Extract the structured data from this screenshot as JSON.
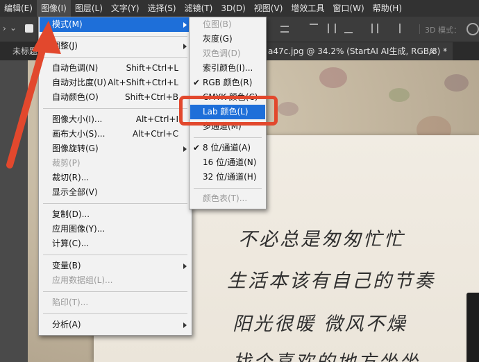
{
  "menubar": {
    "items": [
      "编辑(E)",
      "图像(I)",
      "图层(L)",
      "文字(Y)",
      "选择(S)",
      "滤镜(T)",
      "3D(D)",
      "视图(V)",
      "增效工具",
      "窗口(W)",
      "帮助(H)"
    ]
  },
  "options_bar": {
    "mode_label": "3D 模式："
  },
  "tabs": [
    {
      "label": "未标题"
    },
    {
      "label": "a47c.jpg @ 34.2% (StartAI AI生成, RGB/8) *"
    },
    {
      "close": "×"
    }
  ],
  "image_menu": {
    "items": [
      {
        "label": "模式(M)",
        "shortcut": "",
        "submenu": true,
        "state": "highlight"
      },
      {
        "label": "调整(J)",
        "shortcut": "",
        "submenu": true,
        "state": "normal"
      },
      {
        "label": "自动色调(N)",
        "shortcut": "Shift+Ctrl+L",
        "submenu": false,
        "state": "normal"
      },
      {
        "label": "自动对比度(U)",
        "shortcut": "Alt+Shift+Ctrl+L",
        "submenu": false,
        "state": "normal"
      },
      {
        "label": "自动颜色(O)",
        "shortcut": "Shift+Ctrl+B",
        "submenu": false,
        "state": "normal"
      },
      {
        "label": "图像大小(I)...",
        "shortcut": "Alt+Ctrl+I",
        "submenu": false,
        "state": "normal"
      },
      {
        "label": "画布大小(S)...",
        "shortcut": "Alt+Ctrl+C",
        "submenu": false,
        "state": "normal"
      },
      {
        "label": "图像旋转(G)",
        "shortcut": "",
        "submenu": true,
        "state": "normal"
      },
      {
        "label": "裁剪(P)",
        "shortcut": "",
        "submenu": false,
        "state": "disabled"
      },
      {
        "label": "裁切(R)...",
        "shortcut": "",
        "submenu": false,
        "state": "normal"
      },
      {
        "label": "显示全部(V)",
        "shortcut": "",
        "submenu": false,
        "state": "normal"
      },
      {
        "label": "复制(D)...",
        "shortcut": "",
        "submenu": false,
        "state": "normal"
      },
      {
        "label": "应用图像(Y)...",
        "shortcut": "",
        "submenu": false,
        "state": "normal"
      },
      {
        "label": "计算(C)...",
        "shortcut": "",
        "submenu": false,
        "state": "normal"
      },
      {
        "label": "变量(B)",
        "shortcut": "",
        "submenu": true,
        "state": "normal"
      },
      {
        "label": "应用数据组(L)...",
        "shortcut": "",
        "submenu": false,
        "state": "disabled"
      },
      {
        "label": "陷印(T)...",
        "shortcut": "",
        "submenu": false,
        "state": "disabled"
      },
      {
        "label": "分析(A)",
        "shortcut": "",
        "submenu": true,
        "state": "normal"
      }
    ]
  },
  "mode_menu": {
    "items": [
      {
        "label": "位图(B)",
        "checked": false,
        "state": "disabled"
      },
      {
        "label": "灰度(G)",
        "checked": false,
        "state": "normal"
      },
      {
        "label": "双色调(D)",
        "checked": false,
        "state": "disabled"
      },
      {
        "label": "索引颜色(I)...",
        "checked": false,
        "state": "normal"
      },
      {
        "label": "RGB 颜色(R)",
        "checked": true,
        "state": "normal"
      },
      {
        "label": "CMYK 颜色(C)",
        "checked": false,
        "state": "normal"
      },
      {
        "label": "Lab 颜色(L)",
        "checked": false,
        "state": "highlight"
      },
      {
        "label": "多通道(M)",
        "checked": false,
        "state": "normal"
      },
      {
        "label": "8 位/通道(A)",
        "checked": true,
        "state": "normal"
      },
      {
        "label": "16 位/通道(N)",
        "checked": false,
        "state": "normal"
      },
      {
        "label": "32 位/通道(H)",
        "checked": false,
        "state": "normal"
      },
      {
        "label": "颜色表(T)...",
        "checked": false,
        "state": "disabled"
      }
    ]
  },
  "poem": {
    "line1": "不必总是匆匆忙忙",
    "line2": "生活本该有自己的节奏",
    "line3": "阳光很暖  微风不燥",
    "line4": "找个喜欢的地方坐坐"
  },
  "icons": {
    "check": "✔"
  },
  "colors": {
    "highlight": "#1e6fd9",
    "annotation": "#e2482d"
  }
}
